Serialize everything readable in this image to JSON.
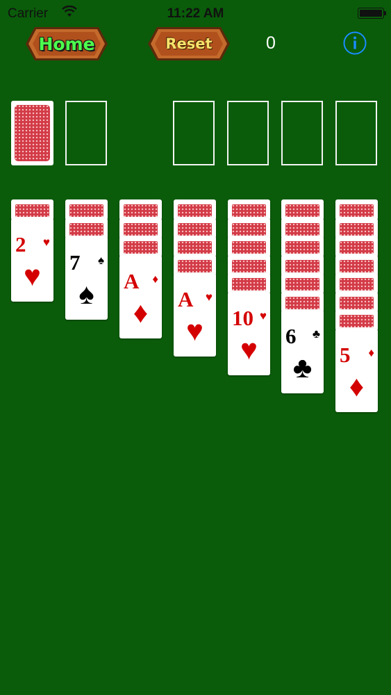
{
  "status": {
    "carrier": "Carrier",
    "time": "11:22 AM"
  },
  "toolbar": {
    "home_label": "Home",
    "reset_label": "Reset",
    "score": "0",
    "info_icon": "info-icon"
  },
  "colors": {
    "felt": "#0a5c0a",
    "card_back": "#d23b47",
    "home_text": "#4dff4d",
    "reset_text": "#f7e36b",
    "info_blue": "#1a8cff"
  },
  "tableau": [
    {
      "face_down": 1,
      "rank": "2",
      "suit": "♥",
      "color": "red"
    },
    {
      "face_down": 2,
      "rank": "7",
      "suit": "♠",
      "color": "black"
    },
    {
      "face_down": 3,
      "rank": "A",
      "suit": "♦",
      "color": "red"
    },
    {
      "face_down": 4,
      "rank": "A",
      "suit": "♥",
      "color": "red"
    },
    {
      "face_down": 5,
      "rank": "10",
      "suit": "♥",
      "color": "red"
    },
    {
      "face_down": 6,
      "rank": "6",
      "suit": "♣",
      "color": "black"
    },
    {
      "face_down": 7,
      "rank": "5",
      "suit": "♦",
      "color": "red"
    }
  ]
}
